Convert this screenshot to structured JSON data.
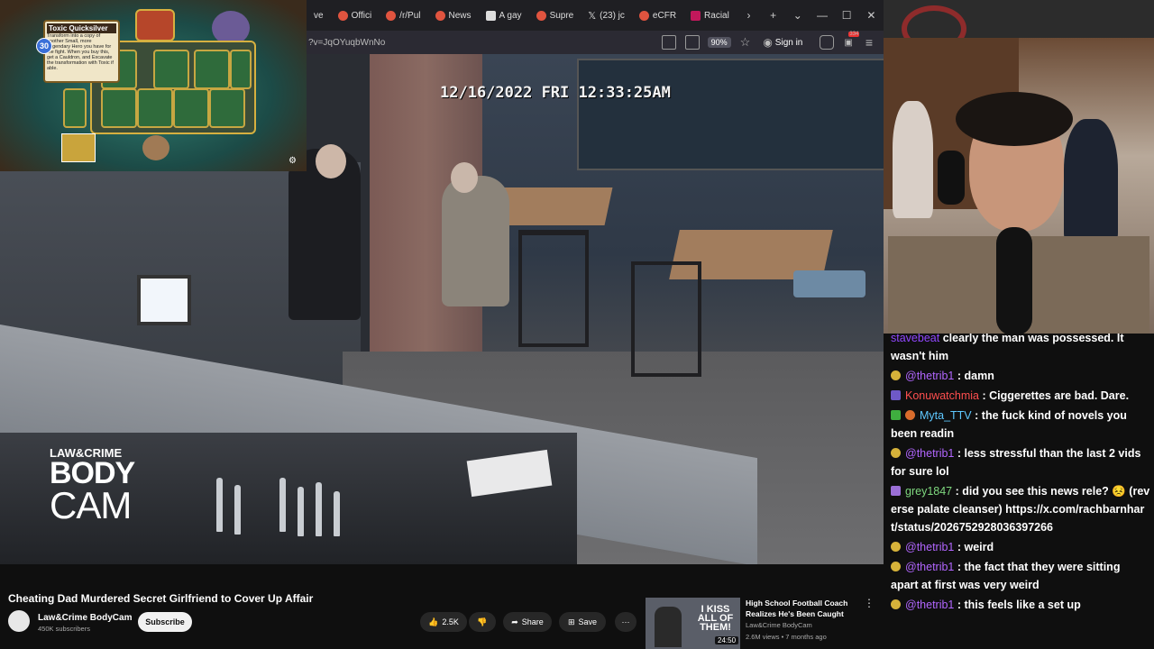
{
  "browser": {
    "tabs": [
      {
        "label": "ve",
        "color": "#cccccc"
      },
      {
        "label": "Offici",
        "color": "#e0543f"
      },
      {
        "label": "/r/Pul",
        "color": "#e0543f"
      },
      {
        "label": "News",
        "color": "#e0543f"
      },
      {
        "label": "A gay",
        "color": "#cccccc"
      },
      {
        "label": "Supre",
        "color": "#e0543f"
      },
      {
        "label": "(23) jc",
        "color": "#ffffff"
      },
      {
        "label": "eCFR",
        "color": "#e0543f"
      },
      {
        "label": "Racial",
        "color": "#e0543f"
      }
    ],
    "new_tab_label": "+",
    "url_text": "?v=JqOYuqbWnNo",
    "zoom": "90%",
    "sign_in_label": "Sign in",
    "notification_count": "334"
  },
  "video": {
    "timestamp": "12/16/2022 FRI 12:33:25AM",
    "watermark": {
      "top": "LAW&CRIME",
      "body": "BODY",
      "cam": "CAM"
    }
  },
  "game": {
    "card_title": "Toxic Quicksilver",
    "card_cost": "30",
    "card_text": "Transform into a copy of another Small, more Legendary Hero you have for the fight. When you buy this, get a Cauldron, and Excavate the transformation with Toxic if able."
  },
  "info": {
    "title": "Cheating Dad Murdered Secret Girlfriend to Cover Up Affair",
    "channel": "Law&Crime BodyCam",
    "subscribers": "450K subscribers",
    "subscribe_label": "Subscribe",
    "likes": "2.5K",
    "share_label": "Share",
    "save_label": "Save",
    "more_label": "···"
  },
  "recommendation": {
    "title": "High School Football Coach Realizes He's Been Caught",
    "channel": "Law&Crime BodyCam",
    "meta": "2.6M views • 7 months ago",
    "duration": "24:50",
    "thumb_text": "I KISS ALL OF THEM!"
  },
  "chat": [
    {
      "badge": "",
      "user": "",
      "user_color": "#9147ff",
      "text": "clearly the man was possessed. It wasn't him",
      "partial": "stavebeat"
    },
    {
      "badge": "coin",
      "user": "@thetrib1",
      "user_color": "#b266ff",
      "text": ": damn"
    },
    {
      "badge": "screen",
      "user": "Konuwatchmia",
      "user_color": "#ff4f4f",
      "text": ": Ciggerettes are bad. Dare."
    },
    {
      "badge": "check",
      "user": "Myta_TTV",
      "user_color": "#5ec8ff",
      "text": ": the fuck kind of novels you been readin"
    },
    {
      "badge": "coin",
      "user": "@thetrib1",
      "user_color": "#b266ff",
      "text": ": less stressful than the last 2 vids for sure lol"
    },
    {
      "badge": "sub",
      "user": "grey1847",
      "user_color": "#7fd87f",
      "text": ": did you see this news rele? 😣 (reverse palate cleanser) https://x.com/rachbarnhart/status/2026752928036397266"
    },
    {
      "badge": "coin",
      "user": "@thetrib1",
      "user_color": "#b266ff",
      "text": ": weird"
    },
    {
      "badge": "coin",
      "user": "@thetrib1",
      "user_color": "#b266ff",
      "text": ": the fact that they were sitting apart at first was very weird"
    },
    {
      "badge": "coin",
      "user": "@thetrib1",
      "user_color": "#b266ff",
      "text": ": this feels like a set up"
    }
  ]
}
